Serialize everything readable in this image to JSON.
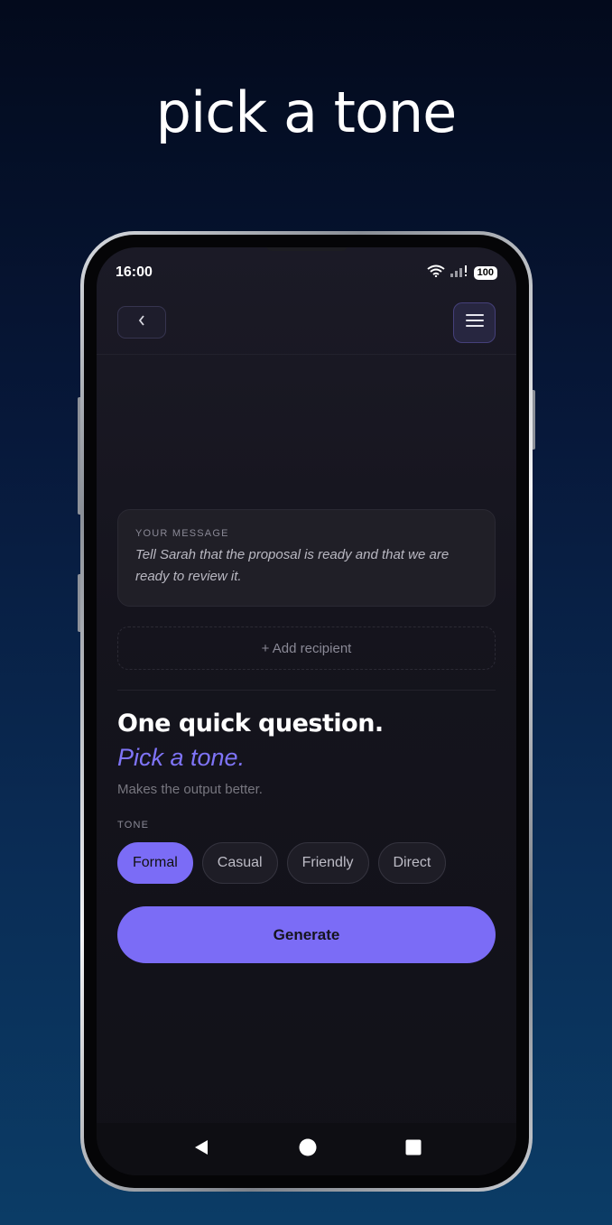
{
  "headline": "pick a tone",
  "status_bar": {
    "time": "16:00",
    "battery": "100"
  },
  "message_card": {
    "label": "YOUR MESSAGE",
    "text": "Tell Sarah that the proposal is ready and that we are ready to review it."
  },
  "add_recipient_label": "+ Add recipient",
  "question": {
    "title": "One quick question.",
    "subtitle": "Pick a tone.",
    "hint": "Makes the output better."
  },
  "tone": {
    "label": "TONE",
    "options": [
      "Formal",
      "Casual",
      "Friendly",
      "Direct"
    ],
    "selected": "Formal"
  },
  "generate_label": "Generate",
  "colors": {
    "accent": "#7b6cf6",
    "screen_bg": "#15141d"
  },
  "icons": [
    "wifi-icon",
    "signal-icon",
    "battery-icon",
    "back-arrow-icon",
    "menu-icon",
    "nav-back-icon",
    "nav-home-icon",
    "nav-recents-icon"
  ]
}
